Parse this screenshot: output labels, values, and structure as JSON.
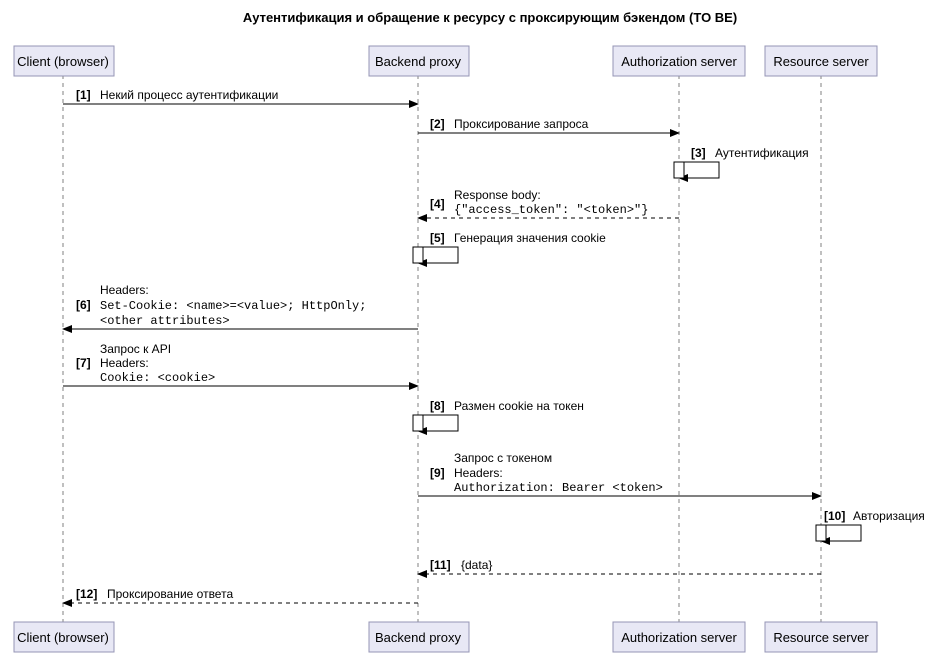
{
  "title": "Аутентификация и обращение к ресурсу с проксирующим бэкендом (TO BE)",
  "participants": {
    "client": "Client (browser)",
    "backend": "Backend proxy",
    "auth": "Authorization server",
    "resource": "Resource server"
  },
  "messages": {
    "m1": {
      "num": "[1]",
      "text": "Некий процесс аутентификации"
    },
    "m2": {
      "num": "[2]",
      "text": "Проксирование запроса"
    },
    "m3": {
      "num": "[3]",
      "text": "Аутентификация"
    },
    "m4": {
      "num": "[4]",
      "line1": "Response body:",
      "line2": "{\"access_token\": \"<token>\"}"
    },
    "m5": {
      "num": "[5]",
      "text": "Генерация значения cookie"
    },
    "m6": {
      "num": "[6]",
      "line1": "Headers:",
      "line2": "Set-Cookie: <name>=<value>; HttpOnly;",
      "line3": "<other attributes>"
    },
    "m7": {
      "num": "[7]",
      "line1": "Запрос к API",
      "line2": "Headers:",
      "line3": "Cookie: <cookie>"
    },
    "m8": {
      "num": "[8]",
      "text": "Размен cookie на токен"
    },
    "m9": {
      "num": "[9]",
      "line1": "Запрос с токеном",
      "line2": "Headers:",
      "line3": "Authorization: Bearer <token>"
    },
    "m10": {
      "num": "[10]",
      "text": "Авторизация"
    },
    "m11": {
      "num": "[11]",
      "text": "{data}"
    },
    "m12": {
      "num": "[12]",
      "text": "Проксирование ответа"
    }
  },
  "chart_data": {
    "type": "sequence-diagram",
    "title": "Аутентификация и обращение к ресурсу с проксирующим бэкендом (TO BE)",
    "participants": [
      "Client (browser)",
      "Backend proxy",
      "Authorization server",
      "Resource server"
    ],
    "messages": [
      {
        "n": 1,
        "from": "Client (browser)",
        "to": "Backend proxy",
        "kind": "sync",
        "label": "Некий процесс аутентификации"
      },
      {
        "n": 2,
        "from": "Backend proxy",
        "to": "Authorization server",
        "kind": "sync",
        "label": "Проксирование запроса"
      },
      {
        "n": 3,
        "from": "Authorization server",
        "to": "Authorization server",
        "kind": "self",
        "label": "Аутентификация"
      },
      {
        "n": 4,
        "from": "Authorization server",
        "to": "Backend proxy",
        "kind": "return",
        "label": "Response body: {\"access_token\": \"<token>\"}"
      },
      {
        "n": 5,
        "from": "Backend proxy",
        "to": "Backend proxy",
        "kind": "self",
        "label": "Генерация значения cookie"
      },
      {
        "n": 6,
        "from": "Backend proxy",
        "to": "Client (browser)",
        "kind": "sync",
        "label": "Headers: Set-Cookie: <name>=<value>; HttpOnly; <other attributes>"
      },
      {
        "n": 7,
        "from": "Client (browser)",
        "to": "Backend proxy",
        "kind": "sync",
        "label": "Запрос к API / Headers: Cookie: <cookie>"
      },
      {
        "n": 8,
        "from": "Backend proxy",
        "to": "Backend proxy",
        "kind": "self",
        "label": "Размен cookie на токен"
      },
      {
        "n": 9,
        "from": "Backend proxy",
        "to": "Resource server",
        "kind": "sync",
        "label": "Запрос с токеном / Headers: Authorization: Bearer <token>"
      },
      {
        "n": 10,
        "from": "Resource server",
        "to": "Resource server",
        "kind": "self",
        "label": "Авторизация"
      },
      {
        "n": 11,
        "from": "Resource server",
        "to": "Backend proxy",
        "kind": "return",
        "label": "{data}"
      },
      {
        "n": 12,
        "from": "Backend proxy",
        "to": "Client (browser)",
        "kind": "return",
        "label": "Проксирование ответа"
      }
    ]
  }
}
